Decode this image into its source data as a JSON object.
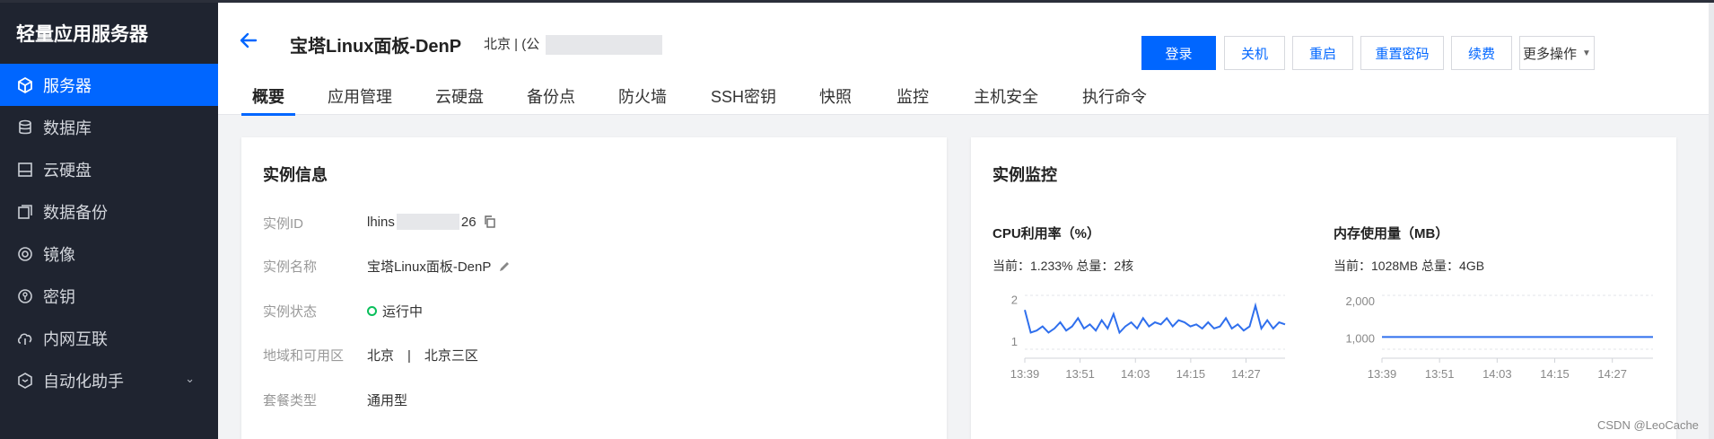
{
  "sidebar": {
    "brand": "轻量应用服务器",
    "items": [
      {
        "label": "服务器",
        "icon": "cube-icon",
        "active": true
      },
      {
        "label": "数据库",
        "icon": "database-icon"
      },
      {
        "label": "云硬盘",
        "icon": "disk-icon"
      },
      {
        "label": "数据备份",
        "icon": "backup-icon"
      },
      {
        "label": "镜像",
        "icon": "image-icon"
      },
      {
        "label": "密钥",
        "icon": "key-icon"
      },
      {
        "label": "内网互联",
        "icon": "link-icon"
      },
      {
        "label": "自动化助手",
        "icon": "automation-icon",
        "has_children": true
      }
    ]
  },
  "header": {
    "title": "宝塔Linux面板-DenP",
    "region": "北京 | (公",
    "actions": [
      "登录",
      "关机",
      "重启",
      "重置密码",
      "续费",
      "更多操作"
    ]
  },
  "tabs": [
    "概要",
    "应用管理",
    "云硬盘",
    "备份点",
    "防火墙",
    "SSH密钥",
    "快照",
    "监控",
    "主机安全",
    "执行命令"
  ],
  "instance": {
    "title": "实例信息",
    "rows": [
      {
        "label": "实例ID",
        "value_prefix": "lhins",
        "value_suffix": "26"
      },
      {
        "label": "实例名称",
        "value": "宝塔Linux面板-DenP"
      },
      {
        "label": "实例状态",
        "value": "运行中"
      },
      {
        "label": "地域和可用区",
        "value": "北京　|　北京三区"
      },
      {
        "label": "套餐类型",
        "value": "通用型"
      }
    ]
  },
  "monitor": {
    "title": "实例监控",
    "cpu": {
      "title": "CPU利用率（%）",
      "current": "当前：1.233% 总量：2核",
      "y_ticks": [
        "2",
        "1"
      ],
      "x_ticks": [
        "13:39",
        "13:51",
        "14:03",
        "14:15",
        "14:27"
      ],
      "values": [
        1.75,
        1.2,
        1.25,
        1.35,
        1.2,
        1.3,
        1.45,
        1.25,
        1.35,
        1.55,
        1.3,
        1.4,
        1.25,
        1.5,
        1.3,
        1.65,
        1.2,
        1.35,
        1.45,
        1.3,
        1.55,
        1.35,
        1.45,
        1.4,
        1.55,
        1.35,
        1.5,
        1.45,
        1.35,
        1.4,
        1.3,
        1.45,
        1.3,
        1.35,
        1.55,
        1.3,
        1.4,
        1.25,
        1.35,
        1.85,
        1.3,
        1.5,
        1.3,
        1.45,
        1.4
      ]
    },
    "mem": {
      "title": "内存使用量（MB）",
      "current": "当前：1028MB 总量：4GB",
      "y_ticks": [
        "2,000",
        "1,000"
      ],
      "x_ticks": [
        "13:39",
        "13:51",
        "14:03",
        "14:15",
        "14:27"
      ],
      "values": [
        1028,
        1028
      ]
    },
    "line_color": "#2f6fed"
  },
  "watermark": "CSDN @LeoCache"
}
